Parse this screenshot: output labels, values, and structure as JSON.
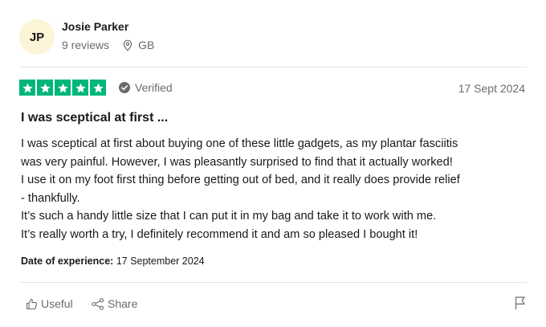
{
  "reviewer": {
    "initials": "JP",
    "name": "Josie Parker",
    "reviews": "9 reviews",
    "country": "GB",
    "avatar_color": "#fcf4d6"
  },
  "review": {
    "rating": 5,
    "rating_max": 5,
    "star_color": "#00b67a",
    "verified_label": "Verified",
    "date": "17 Sept 2024",
    "title": "I was sceptical at first ...",
    "body_lines": [
      "I was sceptical at first about buying one of these little gadgets, as my plantar fasciitis",
      "was very painful. However, I was pleasantly surprised to find that it actually worked!",
      "I use it on my foot first thing before getting out of bed, and it really does provide relief",
      "- thankfully.",
      "It’s such a handy little size that I can put it in my bag and take it to work with me.",
      "It’s really worth a try, I definitely recommend it and am so pleased I bought it!"
    ],
    "experience_label": "Date of experience:",
    "experience_date": "17 September 2024"
  },
  "actions": {
    "useful_label": "Useful",
    "share_label": "Share",
    "icons": [
      "thumbs-up-icon",
      "share-icon",
      "flag-icon"
    ]
  }
}
